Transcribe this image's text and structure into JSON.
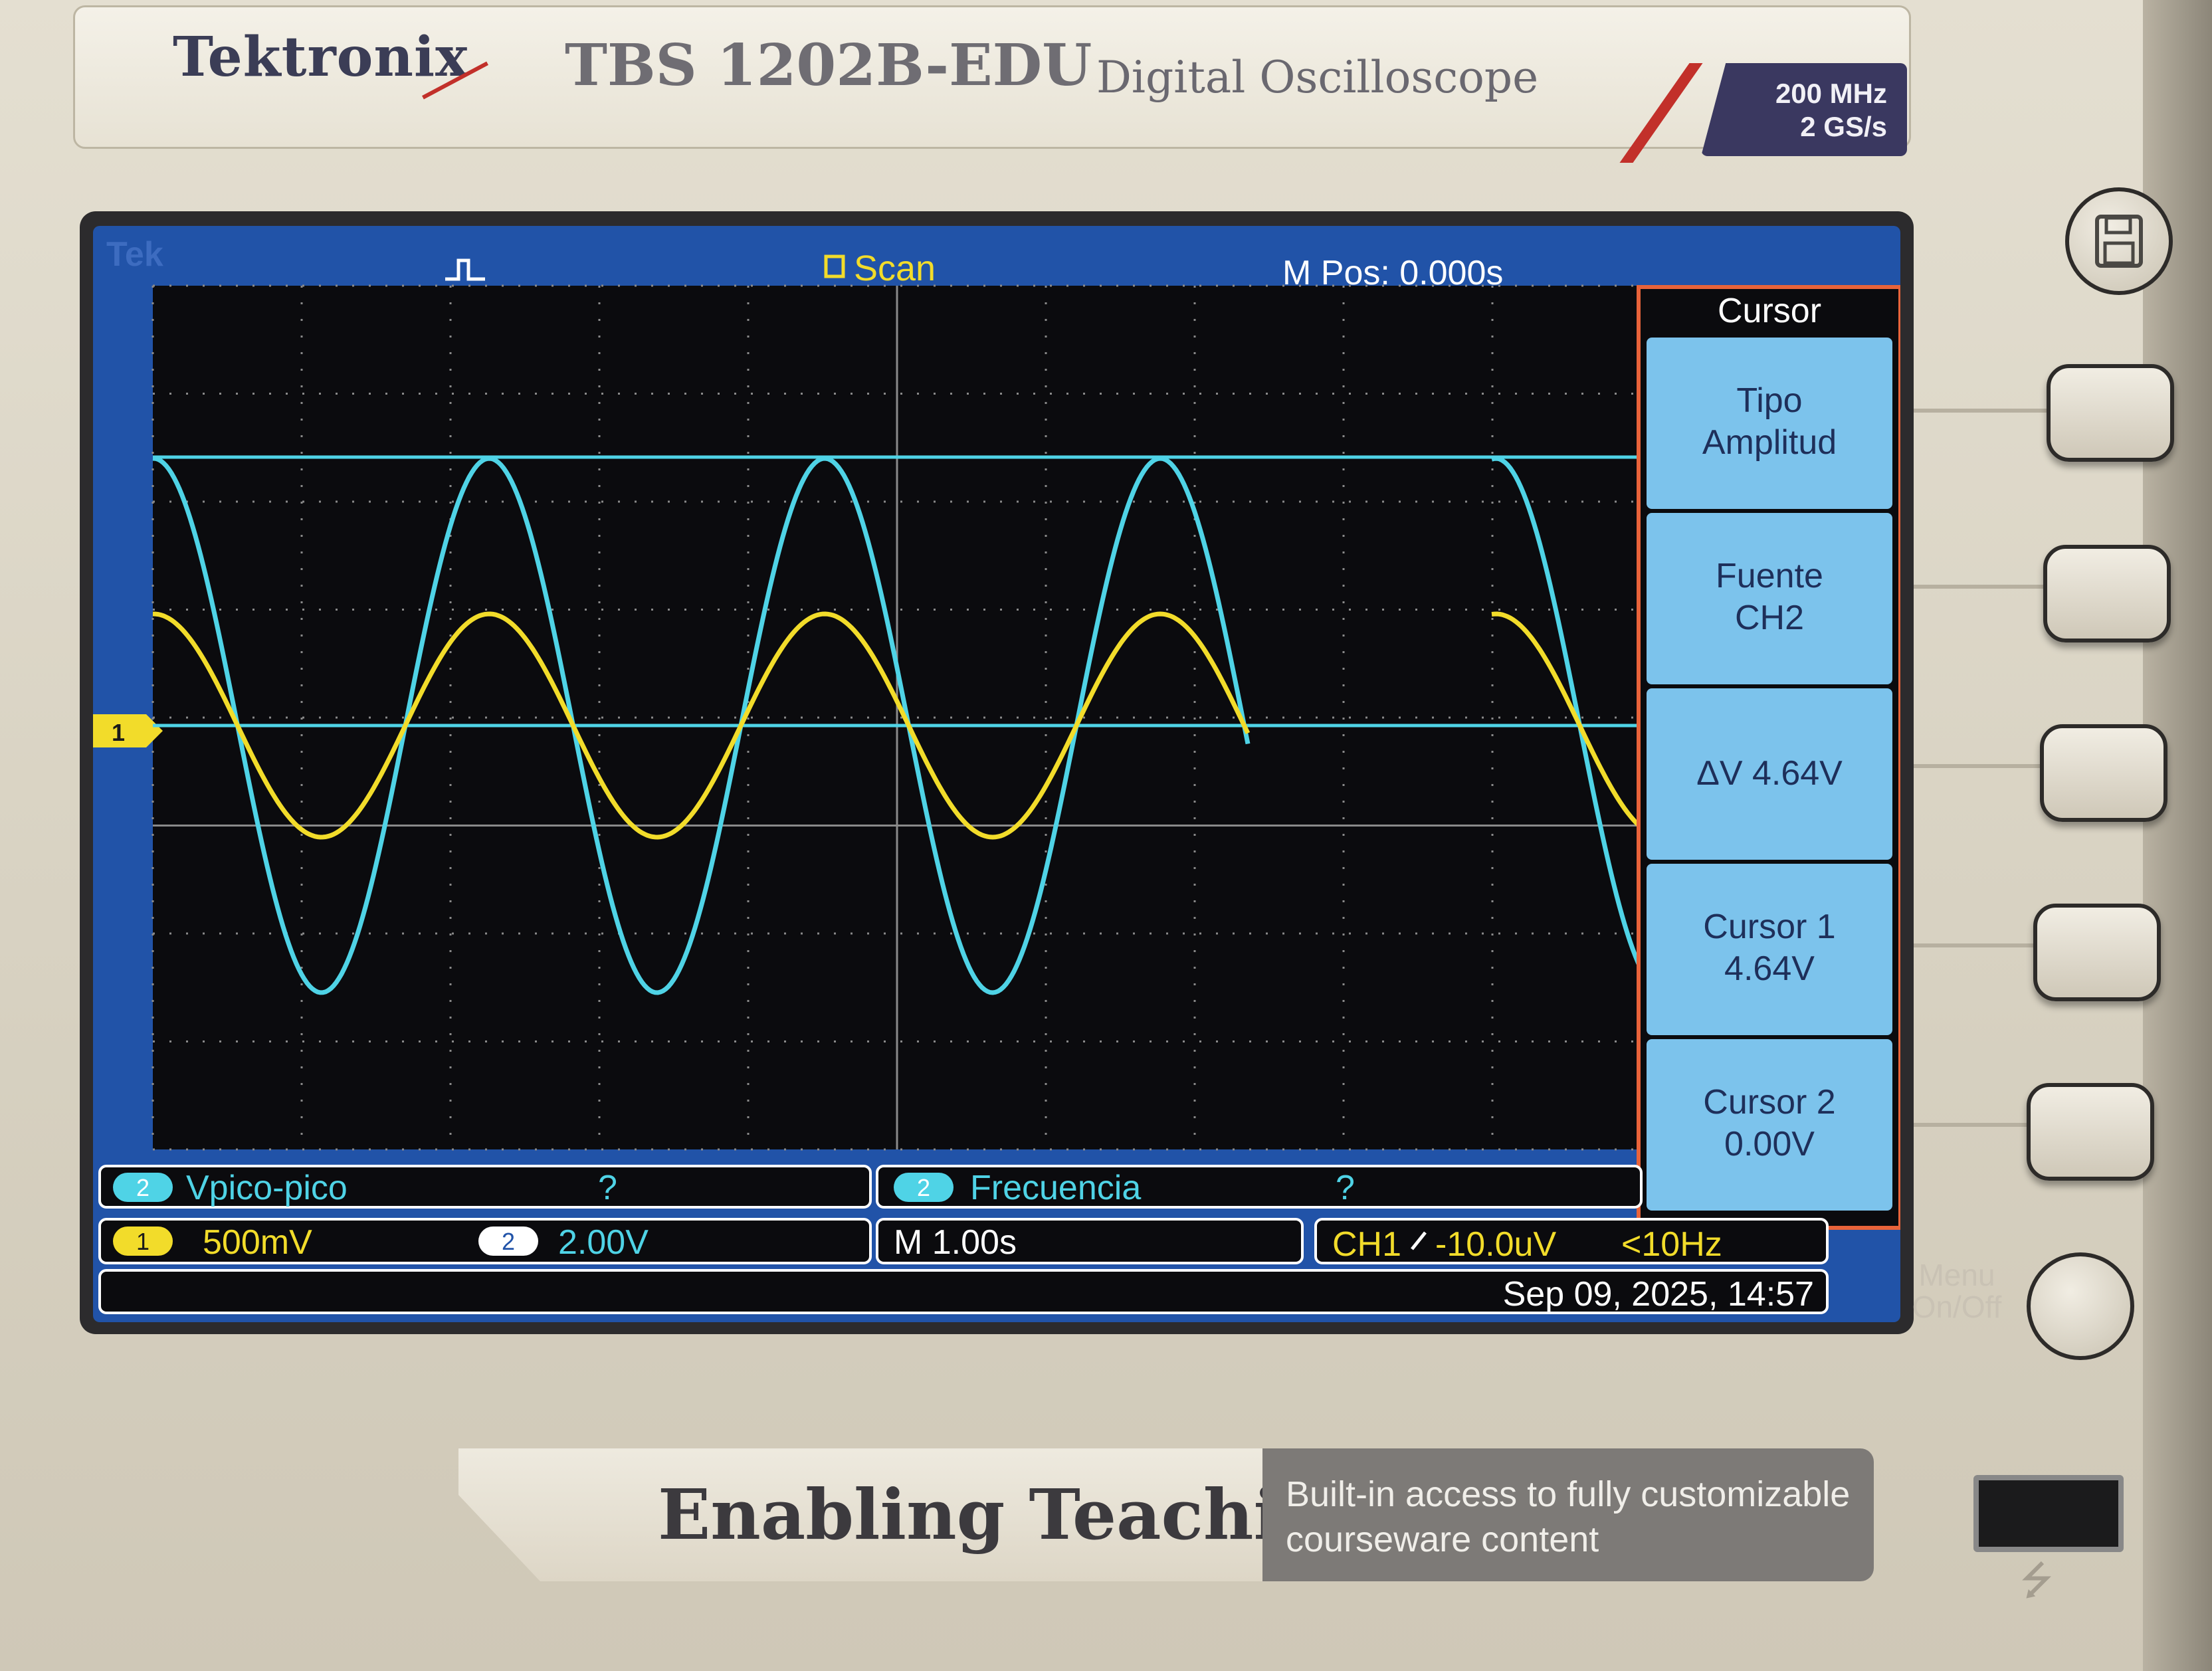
{
  "instrument": {
    "brand": "Tektronix",
    "model": "TBS 1202B-EDU",
    "product_type": "Digital Oscilloscope",
    "bandwidth": "200 MHz",
    "sample_rate": "2 GS/s",
    "tagline": "Enabling Teaching",
    "tagline_desc_1": "Built-in access to fully customizable",
    "tagline_desc_2": "courseware content",
    "menu_button_label_1": "Menu",
    "menu_button_label_2": "On/Off"
  },
  "status_bar": {
    "logo": "Tek",
    "mode": "Scan",
    "mpos": "M Pos: 0.000s"
  },
  "cursor_menu": {
    "title": "Cursor",
    "items": [
      {
        "line1": "Tipo",
        "line2": "Amplitud"
      },
      {
        "line1": "Fuente",
        "line2": "CH2"
      },
      {
        "line1": "ΔV 4.64V",
        "line2": ""
      },
      {
        "line1": "Cursor 1",
        "line2": "4.64V"
      },
      {
        "line1": "Cursor 2",
        "line2": "0.00V"
      }
    ]
  },
  "measurements": [
    {
      "channel": "2",
      "name": "Vpico-pico",
      "value": "?"
    },
    {
      "channel": "2",
      "name": "Frecuencia",
      "value": "?"
    }
  ],
  "settings": {
    "ch1_marker": "1",
    "ch2_marker": "2",
    "ch1_scale": "500mV",
    "ch2_scale": "2.00V",
    "timebase": "M 1.00s",
    "trigger_source": "CH1",
    "trigger_level": "-10.0uV",
    "trigger_freq": "<10Hz",
    "datetime": "Sep 09, 2025, 14:57"
  },
  "colors": {
    "ch1": "#f2dc2a",
    "ch2": "#4fd3e6",
    "screen_bg": "#0b0b0e",
    "ui_blue": "#2153a8",
    "menu_button": "#7cc3ec",
    "menu_border": "#e8633a"
  },
  "icons": {
    "save": "floppy-disk-icon",
    "usb": "usb-icon",
    "trigger": "trigger-pulse-icon"
  }
}
